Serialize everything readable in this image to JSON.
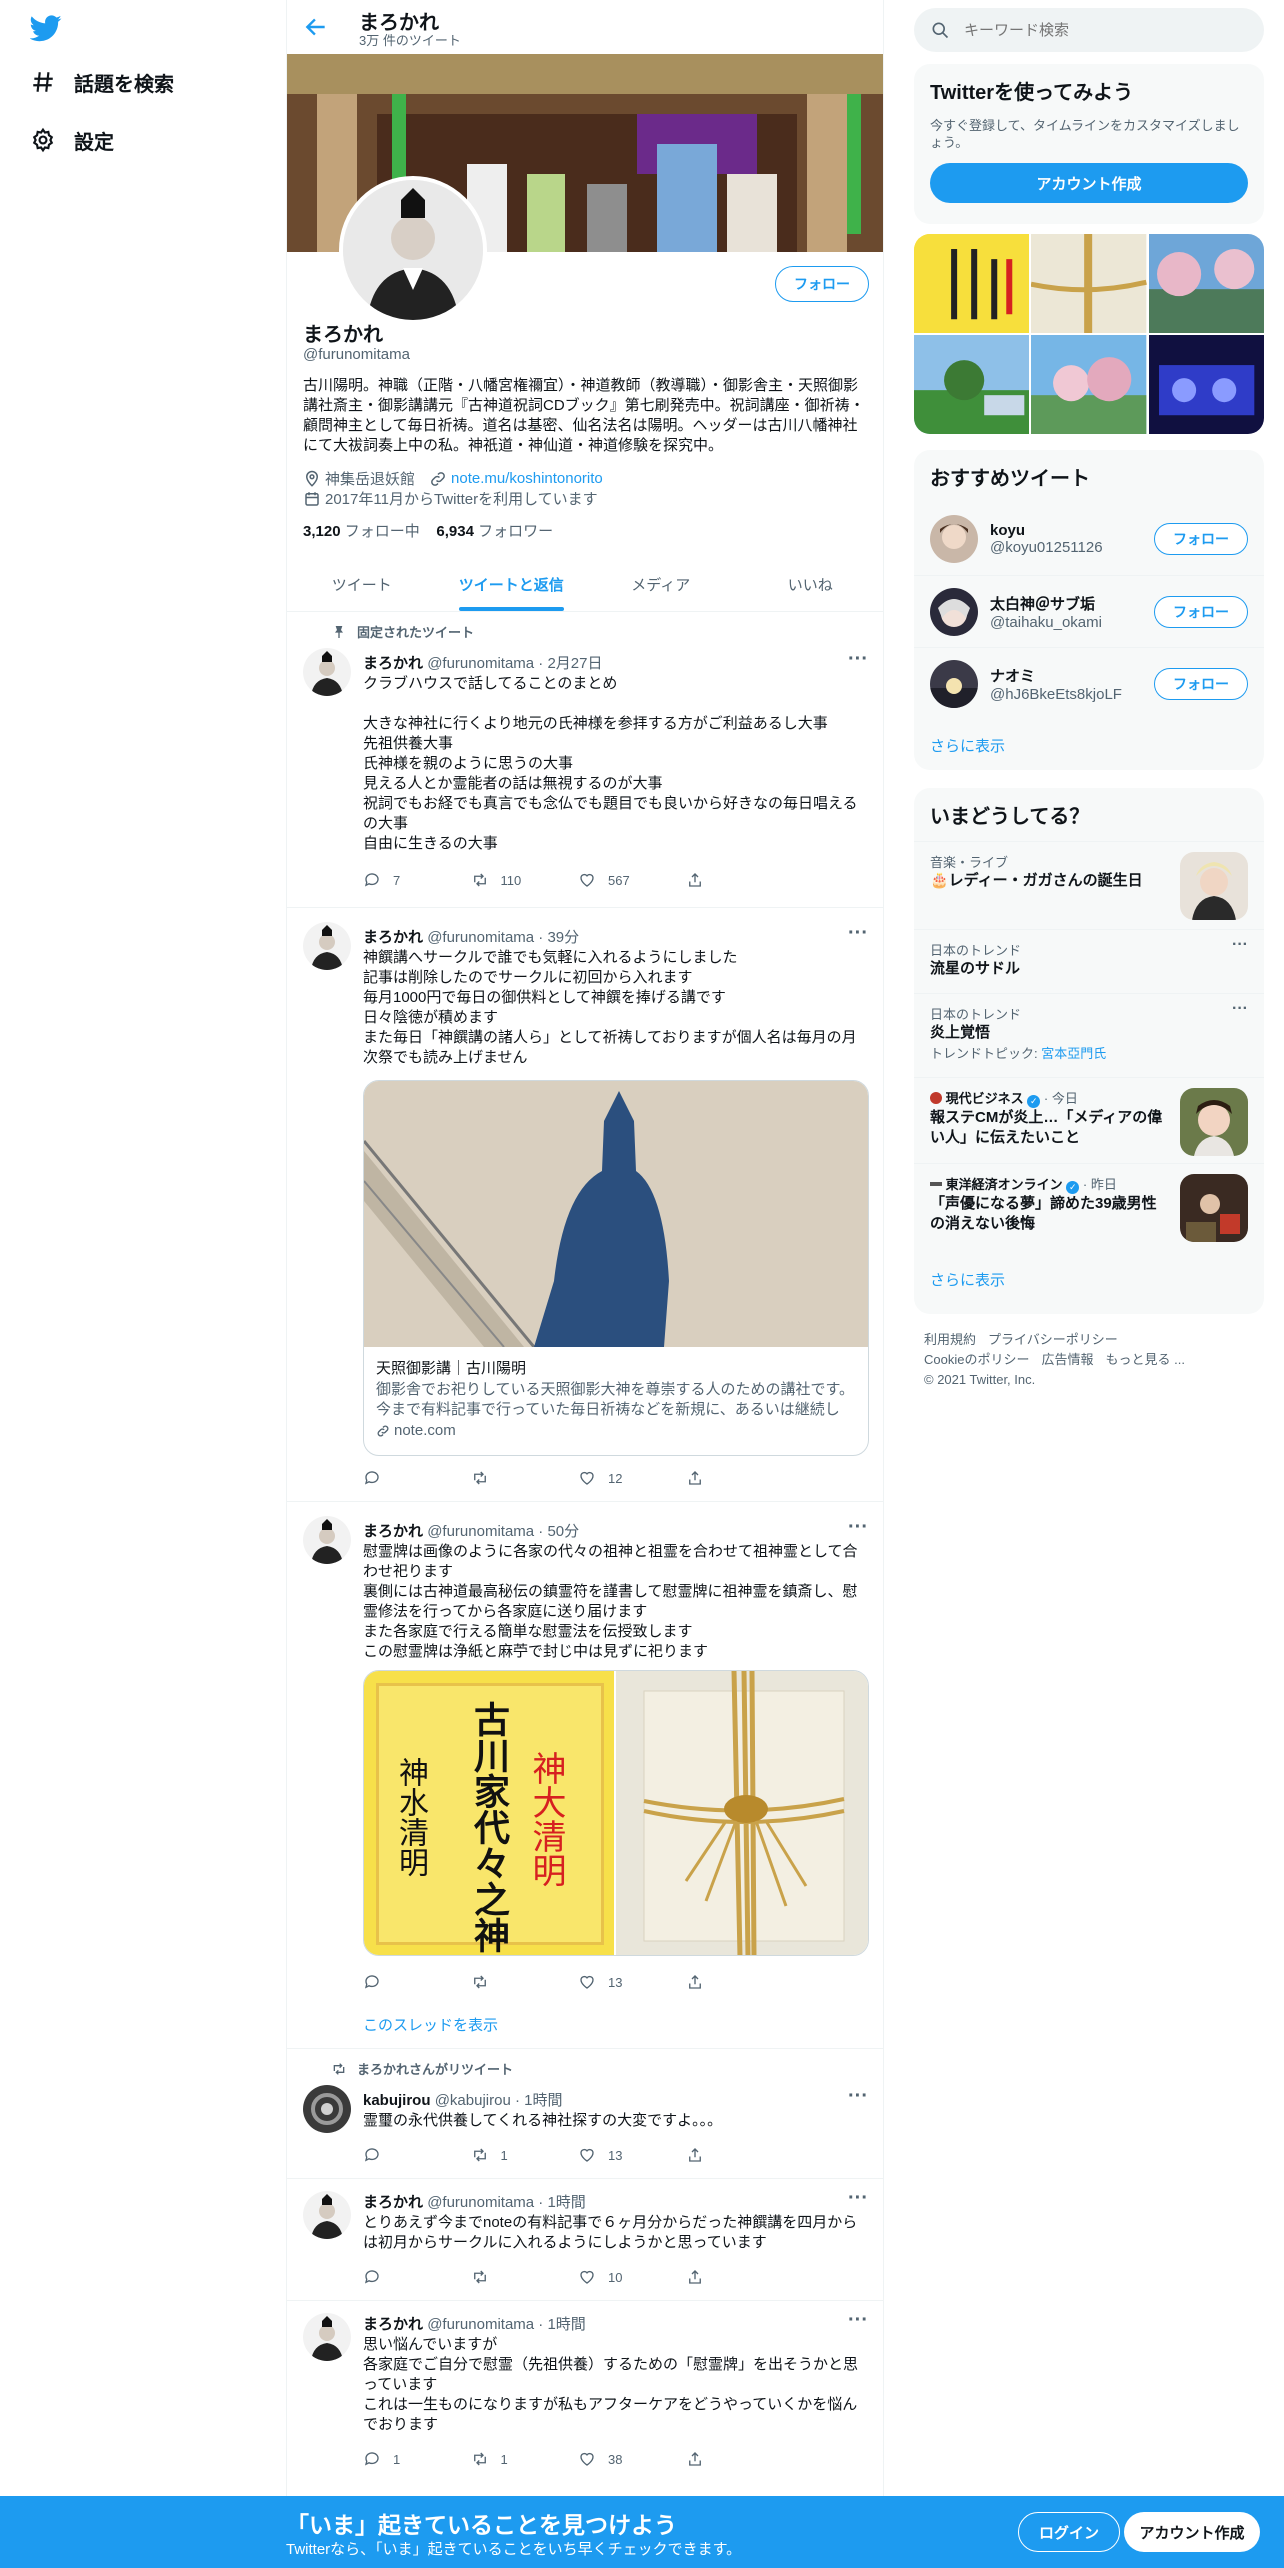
{
  "nav": {
    "items": [
      {
        "label": "話題を検索",
        "icon": "hashtag-icon"
      },
      {
        "label": "設定",
        "icon": "gear-icon"
      }
    ]
  },
  "header": {
    "name": "まろかれ",
    "tweet_count": "3万 件のツイート"
  },
  "profile": {
    "name": "まろかれ",
    "handle": "@furunomitama",
    "follow_label": "フォロー",
    "bio": "古川陽明。神職（正階・八幡宮権禰宜）・神道教師（教導職）・御影舎主・天照御影講社斎主・御影講講元『古神道祝詞CDブック』第七刷発売中。祝詞講座・御祈祷・顧問神主として毎日祈祷。道名は基密、仙名法名は陽明。ヘッダーは古川八幡神社にて大祓詞奏上中の私。神祇道・神仙道・神道修験を探究中。",
    "location": "神集岳退妖館",
    "link": "note.mu/koshintonorito",
    "joined": "2017年11月からTwitterを利用しています",
    "following_count": "3,120",
    "following_label": "フォロー中",
    "followers_count": "6,934",
    "followers_label": "フォロワー"
  },
  "tabs": [
    "ツイート",
    "ツイートと返信",
    "メディア",
    "いいね"
  ],
  "tweets": [
    {
      "context": "固定されたツイート",
      "name": "まろかれ",
      "meta": "@furunomitama · 2月27日",
      "text": "クラブハウスで話してることのまとめ\n\n大きな神社に行くより地元の氏神様を参拝する方がご利益あるし大事\n先祖供養大事\n氏神様を親のように思うの大事\n見える人とか霊能者の話は無視するのが大事\n祝詞でもお経でも真言でも念仏でも題目でも良いから好きなの毎日唱えるの大事\n自由に生きるの大事",
      "replies": "7",
      "retweets": "110",
      "likes": "567"
    },
    {
      "name": "まろかれ",
      "meta": "@furunomitama · 39分",
      "text": "神饌講へサークルで誰でも気軽に入れるようにしました\n記事は削除したのでサークルに初回から入れます\n毎月1000円で毎日の御供料として神饌を捧げる講です\n日々陰徳が積めます\nまた毎日「神饌講の諸人ら」として祈祷しておりますが個人名は毎月の月次祭でも読み上げません",
      "card_title": "天照御影講｜古川陽明",
      "card_desc": "御影舎でお祀りしている天照御影大神を尊崇する人のための講社です。今まで有料記事で行っていた毎日祈祷などを新規に、あるいは継続して…",
      "card_domain": "note.com",
      "replies": "",
      "retweets": "",
      "likes": "12"
    },
    {
      "name": "まろかれ",
      "meta": "@furunomitama · 50分",
      "text": "慰霊牌は画像のように各家の代々の祖神と祖霊を合わせて祖神霊として合わせ祀ります\n裏側には古神道最高秘伝の鎮霊符を謹書して慰霊牌に祖神霊を鎮斎し、慰霊修法を行ってから各家庭に送り届けます\nまた各家庭で行える簡単な慰霊法を伝授致します\nこの慰霊牌は浄紙と麻苧で封じ中は見ずに祀ります",
      "image_text_black_1": "古川家代々之神",
      "image_text_black_2": "神水清明",
      "image_text_red": "神大清明",
      "replies": "",
      "retweets": "",
      "likes": "13",
      "thread_link": "このスレッドを表示"
    },
    {
      "context": "まろかれさんがリツイート",
      "name": "kabujirou",
      "meta": "@kabujirou · 1時間",
      "text": "霊璽の永代供養してくれる神社探すの大変ですよ。。。",
      "replies": "",
      "retweets": "1",
      "likes": "13"
    },
    {
      "name": "まろかれ",
      "meta": "@furunomitama · 1時間",
      "text": "とりあえず今までnoteの有料記事で６ヶ月分からだった神饌講を四月からは初月からサークルに入れるようにしようかと思っています",
      "replies": "",
      "retweets": "",
      "likes": "10"
    },
    {
      "name": "まろかれ",
      "meta": "@furunomitama · 1時間",
      "text": "思い悩んでいますが\n各家庭でご自分で慰霊（先祖供養）するための「慰霊牌」を出そうかと思っています\nこれは一生ものになりますが私もアフターケアをどうやっていくかを悩んでおります",
      "replies": "1",
      "retweets": "1",
      "likes": "38"
    }
  ],
  "search": {
    "placeholder": "キーワード検索"
  },
  "join": {
    "title": "Twitterを使ってみよう",
    "subtitle": "今すぐ登録して、タイムラインをカスタマイズしましょう。",
    "button": "アカウント作成"
  },
  "recommend": {
    "title": "おすすめツイート",
    "users": [
      {
        "name": "koyu",
        "handle": "@koyu01251126"
      },
      {
        "name": "太白神＠サブ垢",
        "handle": "@taihaku_okami"
      },
      {
        "name": "ナオミ",
        "handle": "@hJ6BkeEts8kjoLF"
      }
    ],
    "follow_label": "フォロー",
    "more": "さらに表示"
  },
  "trends": {
    "title": "いまどうしてる？",
    "items": [
      {
        "category": "音楽・ライブ",
        "title": "🎂レディー・ガガさんの誕生日"
      },
      {
        "category": "日本のトレンド",
        "title": "流星のサドル"
      },
      {
        "category": "日本のトレンド",
        "title": "炎上覚悟",
        "sub_label": "トレンドトピック:",
        "sub_value": "宮本亞門氏"
      },
      {
        "category": "現代ビジネス",
        "time": "· 今日",
        "title": "報ステCMが炎上…「メディアの偉い人」に伝えたいこと"
      },
      {
        "category": "東洋経済オンライン",
        "time": "· 昨日",
        "title": "「声優になる夢」諦めた39歳男性の消えない後悔"
      }
    ],
    "more": "さらに表示"
  },
  "footer": {
    "line1": [
      "利用規約",
      "プライバシーポリシー"
    ],
    "line2": [
      "Cookieのポリシー",
      "広告情報",
      "もっと見る ..."
    ],
    "copyright": "© 2021 Twitter, Inc."
  },
  "bottom": {
    "title": "「いま」起きていることを見つけよう",
    "subtitle": "Twitterなら、「いま」起きていることをいち早くチェックできます。",
    "login": "ログイン",
    "signup": "アカウント作成"
  },
  "colors": {
    "accent": "#1d9bf0",
    "text": "#0f1419",
    "muted": "#536471"
  }
}
